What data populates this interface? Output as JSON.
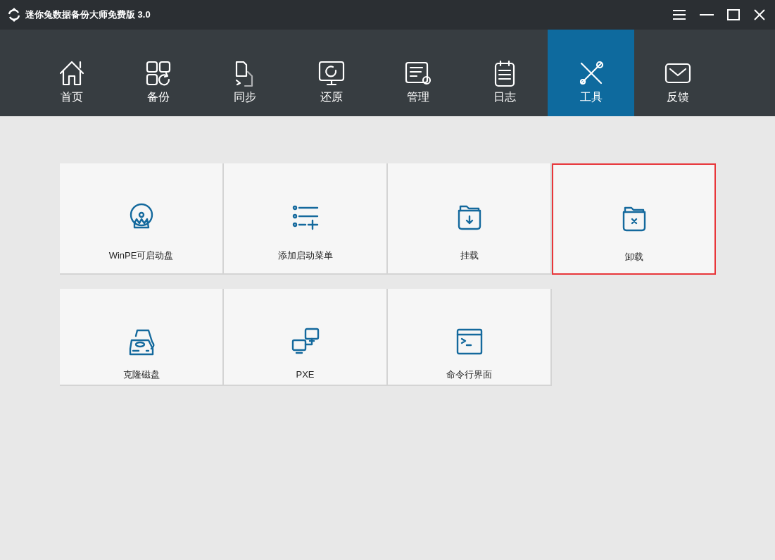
{
  "window": {
    "title": "迷你兔数据备份大师免费版 3.0"
  },
  "nav": [
    {
      "label": "首页",
      "selected": false
    },
    {
      "label": "备份",
      "selected": false
    },
    {
      "label": "同步",
      "selected": false
    },
    {
      "label": "还原",
      "selected": false
    },
    {
      "label": "管理",
      "selected": false
    },
    {
      "label": "日志",
      "selected": false
    },
    {
      "label": "工具",
      "selected": true
    },
    {
      "label": "反馈",
      "selected": false
    }
  ],
  "tools": [
    [
      {
        "label": "WinPE可启动盘",
        "selected": false
      },
      {
        "label": "添加启动菜单",
        "selected": false
      },
      {
        "label": "挂载",
        "selected": false
      },
      {
        "label": "卸载",
        "selected": true
      }
    ],
    [
      {
        "label": "克隆磁盘",
        "selected": false
      },
      {
        "label": "PXE",
        "selected": false
      },
      {
        "label": "命令行界面",
        "selected": false
      }
    ]
  ]
}
